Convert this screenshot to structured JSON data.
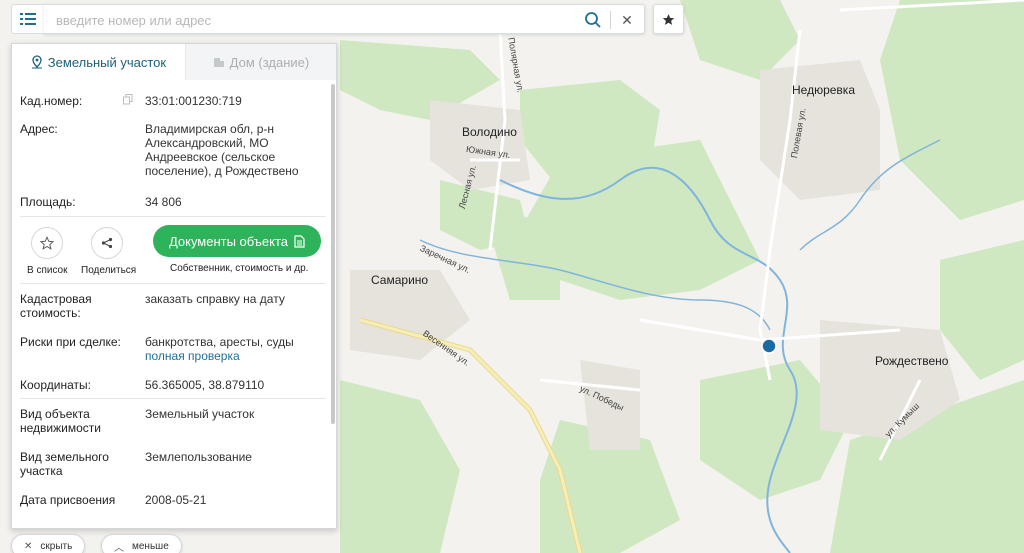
{
  "search": {
    "placeholder": "введите номер или адрес",
    "value": ""
  },
  "icons": {
    "menu": "menu-icon",
    "search": "search-icon",
    "clear": "close-icon",
    "favorite": "star-icon"
  },
  "tabs": [
    {
      "label": "Земельный участок",
      "active": true
    },
    {
      "label": "Дом (здание)",
      "active": false
    }
  ],
  "details": {
    "cad_number": {
      "key": "Кад.номер:",
      "value": "33:01:001230:719"
    },
    "address": {
      "key": "Адрес:",
      "lines": [
        "Владимирская обл, р-н",
        "Александровский, МО",
        "Андреевское (сельское",
        "поселение), д Рождествено"
      ]
    },
    "area": {
      "key": "Площадь:",
      "value": "34 806"
    },
    "cad_value": {
      "key_lines": [
        "Кадастровая",
        "стоимость:"
      ],
      "link": "заказать справку на дату"
    },
    "risks": {
      "key": "Риски при сделке:",
      "value": "банкротства, аресты, суды",
      "link": "полная проверка"
    },
    "coords": {
      "key": "Координаты:",
      "value": "56.365005, 38.879110"
    },
    "object_type": {
      "key_lines": [
        "Вид объекта",
        "недвижимости"
      ],
      "value": "Земельный участок"
    },
    "land_type": {
      "key_lines": [
        "Вид земельного",
        "участка"
      ],
      "value": "Землепользование"
    },
    "assign_date": {
      "key": "Дата присвоения",
      "value": "2008-05-21"
    }
  },
  "actions": {
    "add_list": "В список",
    "share": "Поделиться",
    "docs_button": "Документы объекта",
    "docs_sub": "Собственник, стоимость и др."
  },
  "bottom": {
    "hide": "скрыть",
    "less": "меньше"
  },
  "map": {
    "places": [
      "Недюревка",
      "Володино",
      "Самарино",
      "Рождествено"
    ],
    "streets": [
      "Полевая ул.",
      "Южная ул.",
      "Лесная ул.",
      "Заречная ул.",
      "Весенняя ул.",
      "ул. Победы",
      "ул. Кумыш",
      "Полярная ул."
    ],
    "marker_color": "#1a6aa3",
    "forest_color": "#cfe8c2",
    "field_color": "#f3f2ee"
  },
  "colors": {
    "accent": "#2eb35b",
    "link": "#1e7196",
    "tab_active": "#1d5f7c"
  }
}
